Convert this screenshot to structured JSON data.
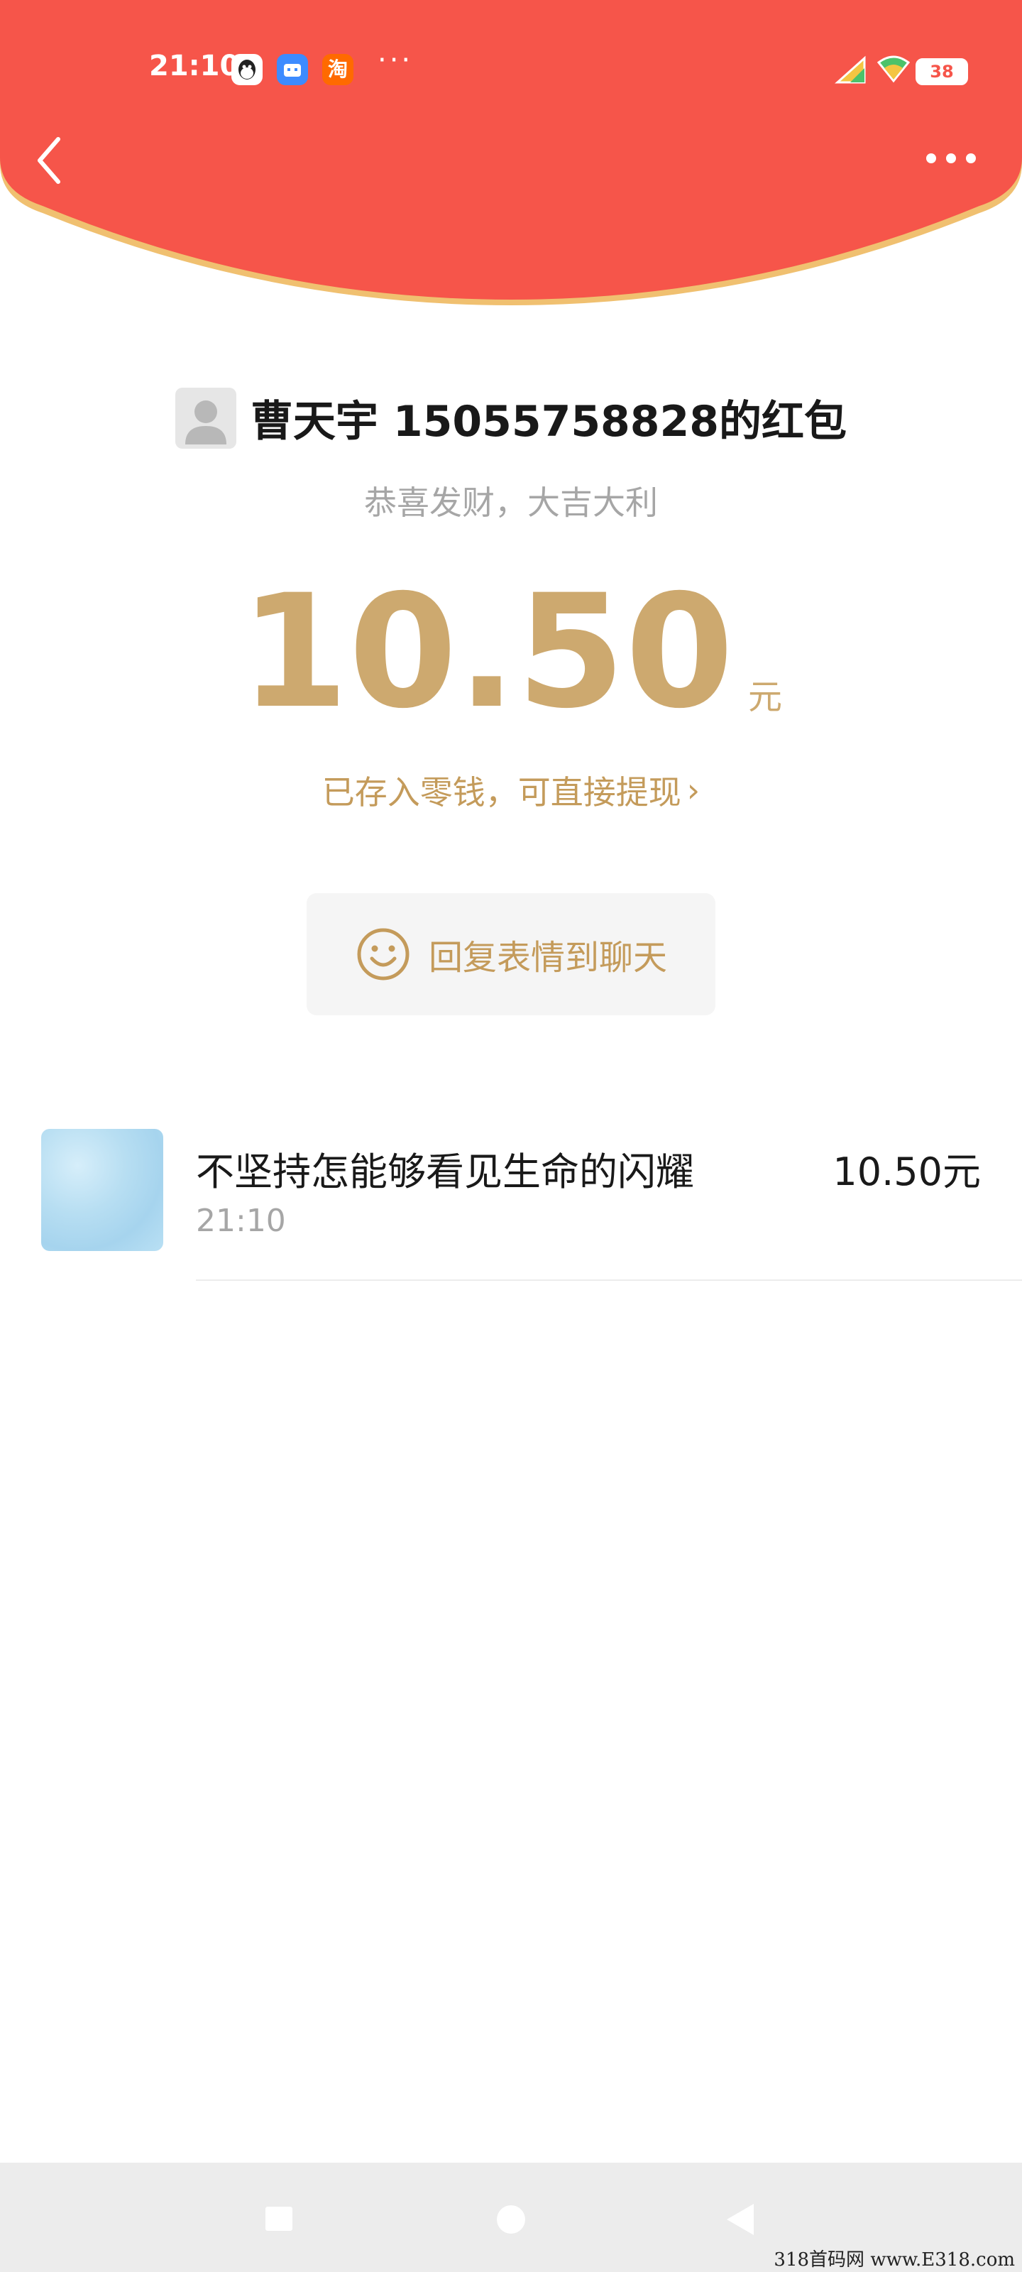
{
  "status_bar": {
    "time": "21:10",
    "app_icons": [
      "qq-icon",
      "bilibili-icon",
      "taobao-icon"
    ],
    "taobao_glyph": "淘",
    "more": "···",
    "battery": "38"
  },
  "header": {
    "back_icon": "chevron-left-icon",
    "more_icon": "more-dots-icon",
    "color": "#f6554a",
    "rim_color": "#f0c070"
  },
  "red_packet": {
    "sender": "曹天宇 15055758828的红包",
    "blessing": "恭喜发财，大吉大利",
    "amount": "10.50",
    "unit": "元",
    "deposit_note": "已存入零钱，可直接提现",
    "deposit_chevron": "›",
    "reply_button": "回复表情到聊天",
    "accent": "#cda96f"
  },
  "receipts": [
    {
      "name": "不坚持怎能够看见生命的闪耀",
      "time": "21:10",
      "amount": "10.50元"
    }
  ],
  "nav_bar": {
    "icons": [
      "recent-apps-icon",
      "home-icon",
      "back-icon"
    ]
  },
  "watermark": "318首码网 www.E318.com"
}
